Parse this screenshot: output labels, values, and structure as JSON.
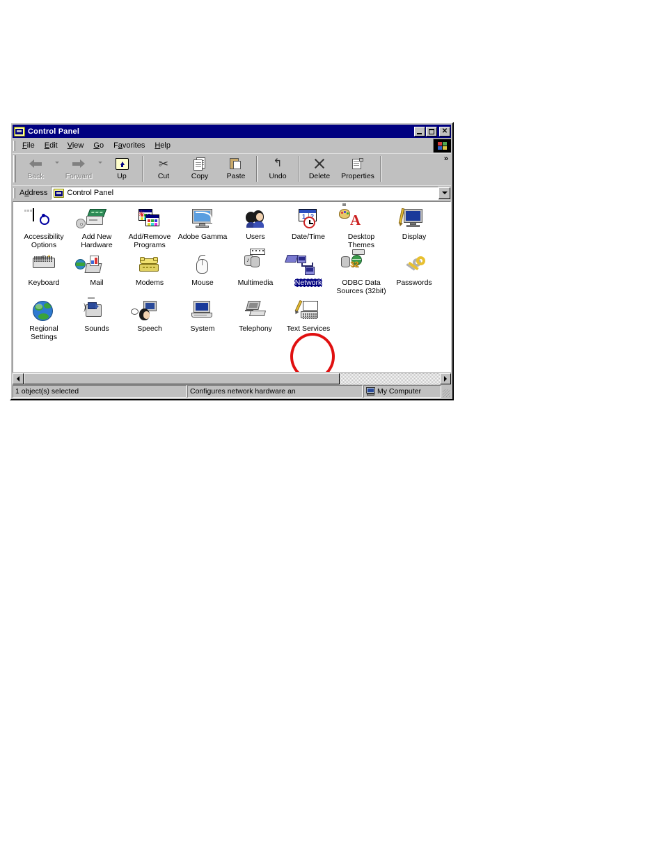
{
  "window": {
    "title": "Control Panel",
    "title_icon": "control-panel-folder-icon",
    "buttons": {
      "minimize": "_",
      "maximize": "□",
      "close": "✕"
    }
  },
  "menu": {
    "items": [
      {
        "label": "File",
        "accel": "F"
      },
      {
        "label": "Edit",
        "accel": "E"
      },
      {
        "label": "View",
        "accel": "V"
      },
      {
        "label": "Go",
        "accel": "G"
      },
      {
        "label": "Favorites",
        "accel": "a"
      },
      {
        "label": "Help",
        "accel": "H"
      }
    ],
    "logo_icon": "windows-flag-logo"
  },
  "toolbar": {
    "overflow_label": "»",
    "buttons": [
      {
        "label": "Back",
        "icon": "back-arrow-icon",
        "disabled": true,
        "dropdown": true
      },
      {
        "label": "Forward",
        "icon": "forward-arrow-icon",
        "disabled": true,
        "dropdown": true
      },
      {
        "label": "Up",
        "icon": "up-folder-icon",
        "disabled": false,
        "dropdown": false
      },
      {
        "label": "Cut",
        "icon": "scissors-icon",
        "disabled": false,
        "dropdown": false
      },
      {
        "label": "Copy",
        "icon": "copy-pages-icon",
        "disabled": false,
        "dropdown": false
      },
      {
        "label": "Paste",
        "icon": "clipboard-paste-icon",
        "disabled": false,
        "dropdown": false
      },
      {
        "label": "Undo",
        "icon": "undo-arrow-icon",
        "disabled": false,
        "dropdown": false
      },
      {
        "label": "Delete",
        "icon": "delete-x-icon",
        "disabled": false,
        "dropdown": false
      },
      {
        "label": "Properties",
        "icon": "properties-clipboard-icon",
        "disabled": false,
        "dropdown": false
      }
    ]
  },
  "address": {
    "label": "Address",
    "value": "Control Panel",
    "icon": "control-panel-folder-icon",
    "dropdown_icon": "chevron-down-icon"
  },
  "items": [
    [
      {
        "label": "Accessibility\nOptions",
        "icon": "accessibility-options-icon",
        "selected": false
      },
      {
        "label": "Add New\nHardware",
        "icon": "add-new-hardware-icon",
        "selected": false
      },
      {
        "label": "Add/Remove\nPrograms",
        "icon": "add-remove-programs-icon",
        "selected": false
      },
      {
        "label": "Adobe Gamma",
        "icon": "adobe-gamma-icon",
        "selected": false
      },
      {
        "label": "Users",
        "icon": "users-icon",
        "selected": false
      },
      {
        "label": "Date/Time",
        "icon": "date-time-icon",
        "selected": false
      },
      {
        "label": "Desktop\nThemes",
        "icon": "desktop-themes-icon",
        "selected": false
      },
      {
        "label": "Display",
        "icon": "display-icon",
        "selected": false
      }
    ],
    [
      {
        "label": "Keyboard",
        "icon": "keyboard-icon",
        "selected": false
      },
      {
        "label": "Mail",
        "icon": "mail-icon",
        "selected": false
      },
      {
        "label": "Modems",
        "icon": "modems-icon",
        "selected": false
      },
      {
        "label": "Mouse",
        "icon": "mouse-icon",
        "selected": false
      },
      {
        "label": "Multimedia",
        "icon": "multimedia-icon",
        "selected": false
      },
      {
        "label": "Network",
        "icon": "network-icon",
        "selected": true
      },
      {
        "label": "ODBC Data\nSources (32bit)",
        "icon": "odbc-data-sources-icon",
        "selected": false
      },
      {
        "label": "Passwords",
        "icon": "passwords-icon",
        "selected": false
      }
    ],
    [
      {
        "label": "Regional\nSettings",
        "icon": "regional-settings-icon",
        "selected": false
      },
      {
        "label": "Sounds",
        "icon": "sounds-icon",
        "selected": false
      },
      {
        "label": "Speech",
        "icon": "speech-icon",
        "selected": false
      },
      {
        "label": "System",
        "icon": "system-icon",
        "selected": false
      },
      {
        "label": "Telephony",
        "icon": "telephony-icon",
        "selected": false
      },
      {
        "label": "Text Services",
        "icon": "text-services-icon",
        "selected": false
      }
    ]
  ],
  "annotation": {
    "shape": "red-circle-highlight",
    "target": "Network",
    "color": "#e01010"
  },
  "status_bar": {
    "left": "1 object(s) selected",
    "middle": "Configures network hardware an",
    "right": "My Computer",
    "right_icon": "my-computer-icon"
  },
  "scrollbar": {
    "left_arrow": "◀",
    "right_arrow": "▶"
  },
  "colors": {
    "titlebar": "#000080",
    "window_face": "#c0c0c0",
    "selection": "#000080",
    "annotation": "#e01010"
  }
}
